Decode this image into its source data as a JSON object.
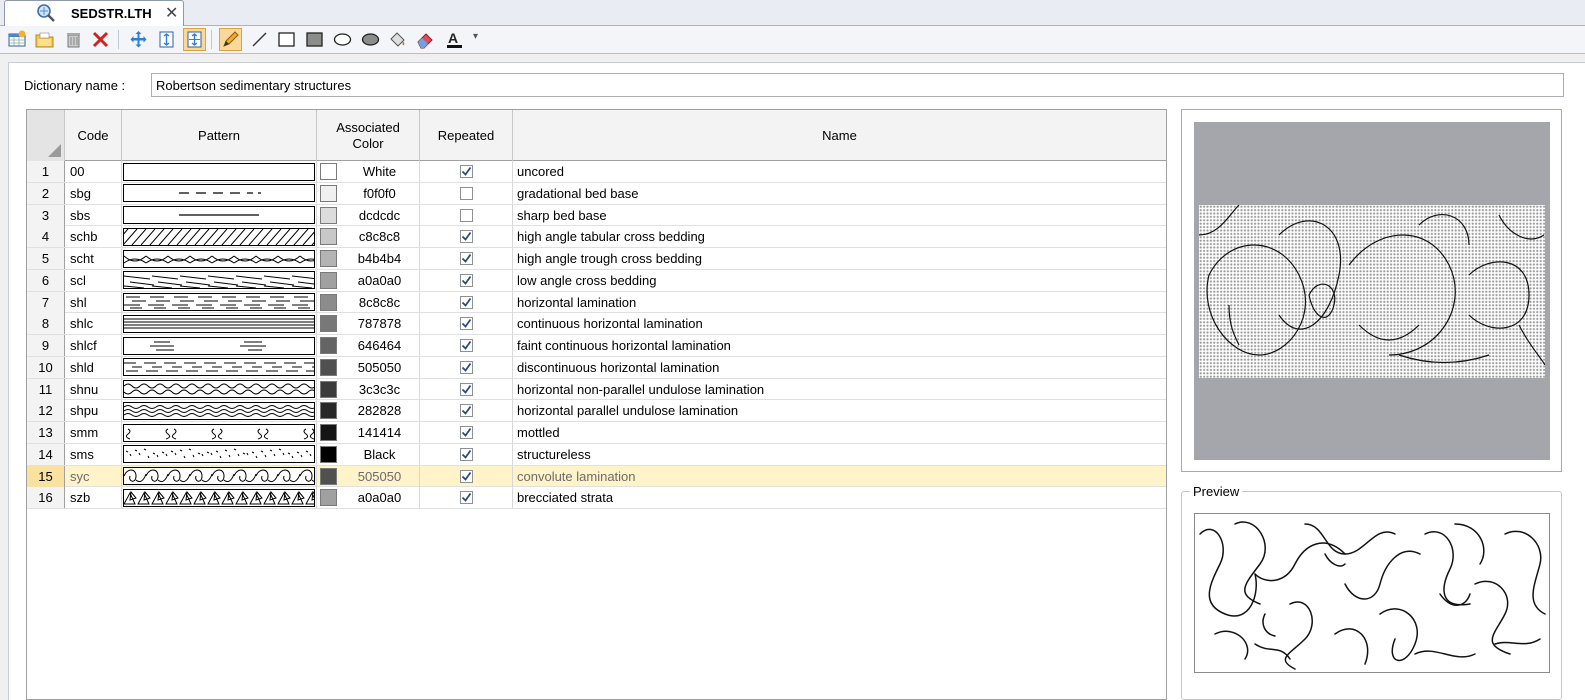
{
  "tab": {
    "title": "SEDSTR.LTH",
    "icon": "magnifier-globe-icon",
    "close": "✕"
  },
  "toolbar": {
    "buttons": [
      {
        "name": "new-dictionary-button",
        "icon": "table-add-icon"
      },
      {
        "name": "open-dictionary-button",
        "icon": "folder-open-icon"
      },
      {
        "name": "delete-button",
        "icon": "trash-icon"
      },
      {
        "name": "remove-button",
        "icon": "red-x-icon"
      },
      {
        "name": "move-button",
        "icon": "move-arrows-icon"
      },
      {
        "name": "fit-height-button",
        "icon": "fit-height-icon"
      },
      {
        "name": "fit-all-button",
        "icon": "fit-all-icon"
      },
      {
        "name": "pencil-tool-button",
        "icon": "pencil-icon"
      },
      {
        "name": "line-tool-button",
        "icon": "line-icon"
      },
      {
        "name": "rectangle-tool-button",
        "icon": "rectangle-icon"
      },
      {
        "name": "filled-rectangle-tool-button",
        "icon": "filled-rectangle-icon"
      },
      {
        "name": "ellipse-tool-button",
        "icon": "ellipse-icon"
      },
      {
        "name": "filled-ellipse-tool-button",
        "icon": "filled-ellipse-icon"
      },
      {
        "name": "fill-bucket-tool-button",
        "icon": "paint-bucket-icon"
      },
      {
        "name": "eraser-tool-button",
        "icon": "eraser-icon"
      },
      {
        "name": "text-color-button",
        "icon": "font-color-icon"
      }
    ],
    "dropdown_glyph": "▾"
  },
  "form": {
    "dict_label": "Dictionary name :",
    "dict_value": "Robertson sedimentary structures"
  },
  "grid": {
    "columns": {
      "code": "Code",
      "pattern": "Pattern",
      "color": "Associated Color",
      "repeated": "Repeated",
      "name": "Name"
    },
    "rows": [
      {
        "num": "1",
        "code": "00",
        "pattern": "blank",
        "color": "#ffffff",
        "hex": "White",
        "repeated": true,
        "name": "uncored"
      },
      {
        "num": "2",
        "code": "sbg",
        "pattern": "dashed",
        "color": "#f0f0f0",
        "hex": "f0f0f0",
        "repeated": false,
        "name": "gradational bed base"
      },
      {
        "num": "3",
        "code": "sbs",
        "pattern": "line",
        "color": "#dcdcdc",
        "hex": "dcdcdc",
        "repeated": false,
        "name": "sharp bed base"
      },
      {
        "num": "4",
        "code": "schb",
        "pattern": "diagonal",
        "color": "#c8c8c8",
        "hex": "c8c8c8",
        "repeated": true,
        "name": "high angle tabular cross bedding"
      },
      {
        "num": "5",
        "code": "scht",
        "pattern": "trough",
        "color": "#b4b4b4",
        "hex": "b4b4b4",
        "repeated": true,
        "name": "high angle trough cross bedding"
      },
      {
        "num": "6",
        "code": "scl",
        "pattern": "lowangle",
        "color": "#a0a0a0",
        "hex": "a0a0a0",
        "repeated": true,
        "name": "low angle cross bedding"
      },
      {
        "num": "7",
        "code": "shl",
        "pattern": "hlam",
        "color": "#8c8c8c",
        "hex": "8c8c8c",
        "repeated": true,
        "name": "horizontal lamination"
      },
      {
        "num": "8",
        "code": "shlc",
        "pattern": "hlamc",
        "color": "#787878",
        "hex": "787878",
        "repeated": true,
        "name": "continuous horizontal lamination"
      },
      {
        "num": "9",
        "code": "shlcf",
        "pattern": "faint",
        "color": "#646464",
        "hex": "646464",
        "repeated": true,
        "name": "faint continuous horizontal lamination"
      },
      {
        "num": "10",
        "code": "shld",
        "pattern": "disc",
        "color": "#505050",
        "hex": "505050",
        "repeated": true,
        "name": "discontinuous horizontal lamination"
      },
      {
        "num": "11",
        "code": "shnu",
        "pattern": "nonparallel",
        "color": "#3c3c3c",
        "hex": "3c3c3c",
        "repeated": true,
        "name": "horizontal non-parallel undulose lamination"
      },
      {
        "num": "12",
        "code": "shpu",
        "pattern": "wavy",
        "color": "#282828",
        "hex": "282828",
        "repeated": true,
        "name": "horizontal parallel undulose lamination"
      },
      {
        "num": "13",
        "code": "smm",
        "pattern": "mottled",
        "color": "#141414",
        "hex": "141414",
        "repeated": true,
        "name": "mottled"
      },
      {
        "num": "14",
        "code": "sms",
        "pattern": "dots",
        "color": "#000000",
        "hex": "Black",
        "repeated": true,
        "name": "structureless"
      },
      {
        "num": "15",
        "code": "syc",
        "pattern": "convolute",
        "color": "#505050",
        "hex": "505050",
        "repeated": true,
        "name": "convolute lamination",
        "selected": true
      },
      {
        "num": "16",
        "code": "szb",
        "pattern": "breccia",
        "color": "#a0a0a0",
        "hex": "a0a0a0",
        "repeated": true,
        "name": "brecciated strata"
      }
    ]
  },
  "preview": {
    "label": "Preview"
  },
  "colors": {
    "selected_row": "#fff3c9",
    "toolbar_active": "#f9d89a"
  }
}
